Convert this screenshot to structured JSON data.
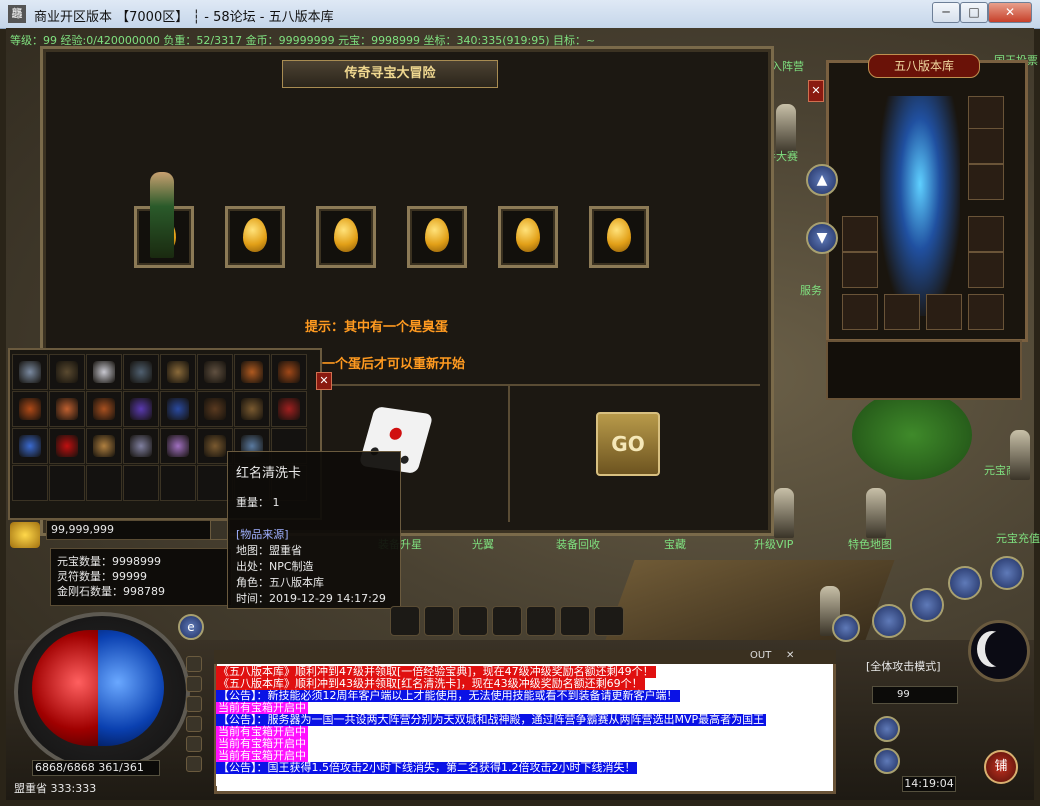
{
  "window": {
    "title": "商业开区版本 【7000区】 ┆ - 58论坛 - 五八版本库",
    "app_icon": "game-icon",
    "min_label": "─",
    "max_label": "□",
    "close_label": "✕"
  },
  "statusline": "等级：99 经验:0/420000000 负重：52/3317 金币：99999999 元宝：9998999 坐标：340:335(919:95) 目标：~",
  "treasure": {
    "title": "传奇寻宝大冒险",
    "hint1": "提示：其中有一个是臭蛋",
    "hint2": "完一个蛋后才可以重新开始",
    "go_label": "GO",
    "eggs": 6
  },
  "bag": {
    "close_label": "✕",
    "gold": "99,999,999"
  },
  "currency": {
    "yuanbao": "元宝数量：9998999",
    "lingfu": "灵符数量：99999",
    "jingang": "金刚石数量：998789"
  },
  "tooltip": {
    "name": "红名清洗卡",
    "weight": "重量： 1",
    "source_header": "[物品来源]",
    "map": "地图：盟重省",
    "origin": "出处：NPC制造",
    "role": "角色：五八版本库",
    "time": "时间：2019-12-29 14:17:29"
  },
  "equip": {
    "title": "五八版本库",
    "close_label": "✕"
  },
  "npcs": {
    "n1": "加入阵营",
    "n2": "国王投票",
    "n3": "新手大赛",
    "n4": "元宝商店",
    "n5": "服务",
    "n6": "升级VIP",
    "n7": "特色地图",
    "n8": "装备回收",
    "n9": "宝藏",
    "n10": "光翼",
    "n11": "装备升星",
    "n12": "元宝充值"
  },
  "hud": {
    "hpmp": "6868/6868 361/361",
    "map": "盟重省 333:333",
    "attack_mode": "[全体攻击模式]",
    "clock": "14:19:04",
    "store_label": "铺",
    "level": "99",
    "chat_out_label": "OUT",
    "chat_close_label": "✕"
  },
  "chat": [
    {
      "text": "《五八版本库》顺利冲到47级并领取[一倍经验宝典]，现在47级冲级奖励名额还剩49个！",
      "color": "red"
    },
    {
      "text": "《五八版本库》顺利冲到43级并领取[红名清洗卡]，现在43级冲级奖励名额还剩69个！",
      "color": "red"
    },
    {
      "text": "【公告】：新技能必须12周年客户端以上才能使用，无法使用技能或看不到装备请更新客户端！",
      "color": "blue"
    },
    {
      "text": "当前有宝箱开启中",
      "color": "mag"
    },
    {
      "text": "【公告】：服务器为一国一共设两大阵营分别为天双城和战神殿，通过阵营争霸赛从两阵营选出MVP最高者为国王",
      "color": "blue"
    },
    {
      "text": "当前有宝箱开启中",
      "color": "mag"
    },
    {
      "text": "当前有宝箱开启中",
      "color": "mag"
    },
    {
      "text": "当前有宝箱开启中",
      "color": "mag"
    },
    {
      "text": "【公告】：国王获得1.5倍攻击2小时下线消失，第二名获得1.2倍攻击2小时下线消失！",
      "color": "blue"
    }
  ]
}
